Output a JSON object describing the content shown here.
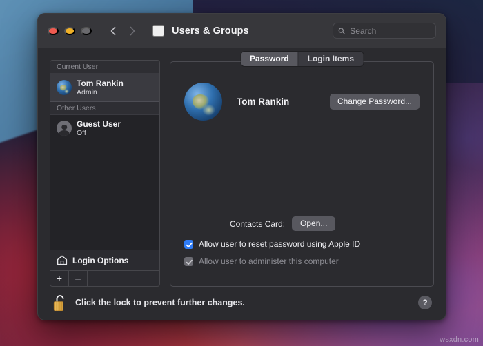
{
  "desktop": {
    "watermark": "wsxdn.com"
  },
  "window": {
    "title": "Users & Groups",
    "traffic_lights": {
      "close": "close",
      "minimize": "minimize",
      "zoom": "zoom"
    },
    "nav": {
      "back": "Back",
      "forward": "Forward"
    },
    "grid_button": "Show All",
    "search": {
      "placeholder": "Search",
      "value": ""
    }
  },
  "sidebar": {
    "groups": [
      {
        "header": "Current User",
        "users": [
          {
            "name": "Tom Rankin",
            "status": "Admin",
            "avatar": "earth-avatar",
            "selected": true
          }
        ]
      },
      {
        "header": "Other Users",
        "users": [
          {
            "name": "Guest User",
            "status": "Off",
            "avatar": "person-avatar",
            "selected": false
          }
        ]
      }
    ],
    "login_options_label": "Login Options",
    "add_button": "+",
    "remove_button": "–"
  },
  "main": {
    "tabs": [
      {
        "label": "Password",
        "active": true
      },
      {
        "label": "Login Items",
        "active": false
      }
    ],
    "account": {
      "full_name": "Tom Rankin",
      "avatar": "earth-avatar",
      "change_password_label": "Change Password..."
    },
    "contacts_card": {
      "label": "Contacts Card:",
      "open_label": "Open..."
    },
    "checkboxes": [
      {
        "label": "Allow user to reset password using Apple ID",
        "checked": true,
        "disabled": false
      },
      {
        "label": "Allow user to administer this computer",
        "checked": true,
        "disabled": true
      }
    ]
  },
  "footer": {
    "lock_icon": "unlocked-padlock-icon",
    "lock_text": "Click the lock to prevent further changes.",
    "help_label": "?"
  },
  "colors": {
    "accent_blue": "#2f7cf6",
    "window_bg": "#2b2b2f",
    "titlebar_bg": "#37373b",
    "sidebar_bg": "#232327",
    "selection_bg": "#3a3a40",
    "lock_gold": "#d9a441",
    "traffic_close": "#f05b51",
    "traffic_min": "#f0b128",
    "traffic_zoom": "#6a6a6e"
  }
}
